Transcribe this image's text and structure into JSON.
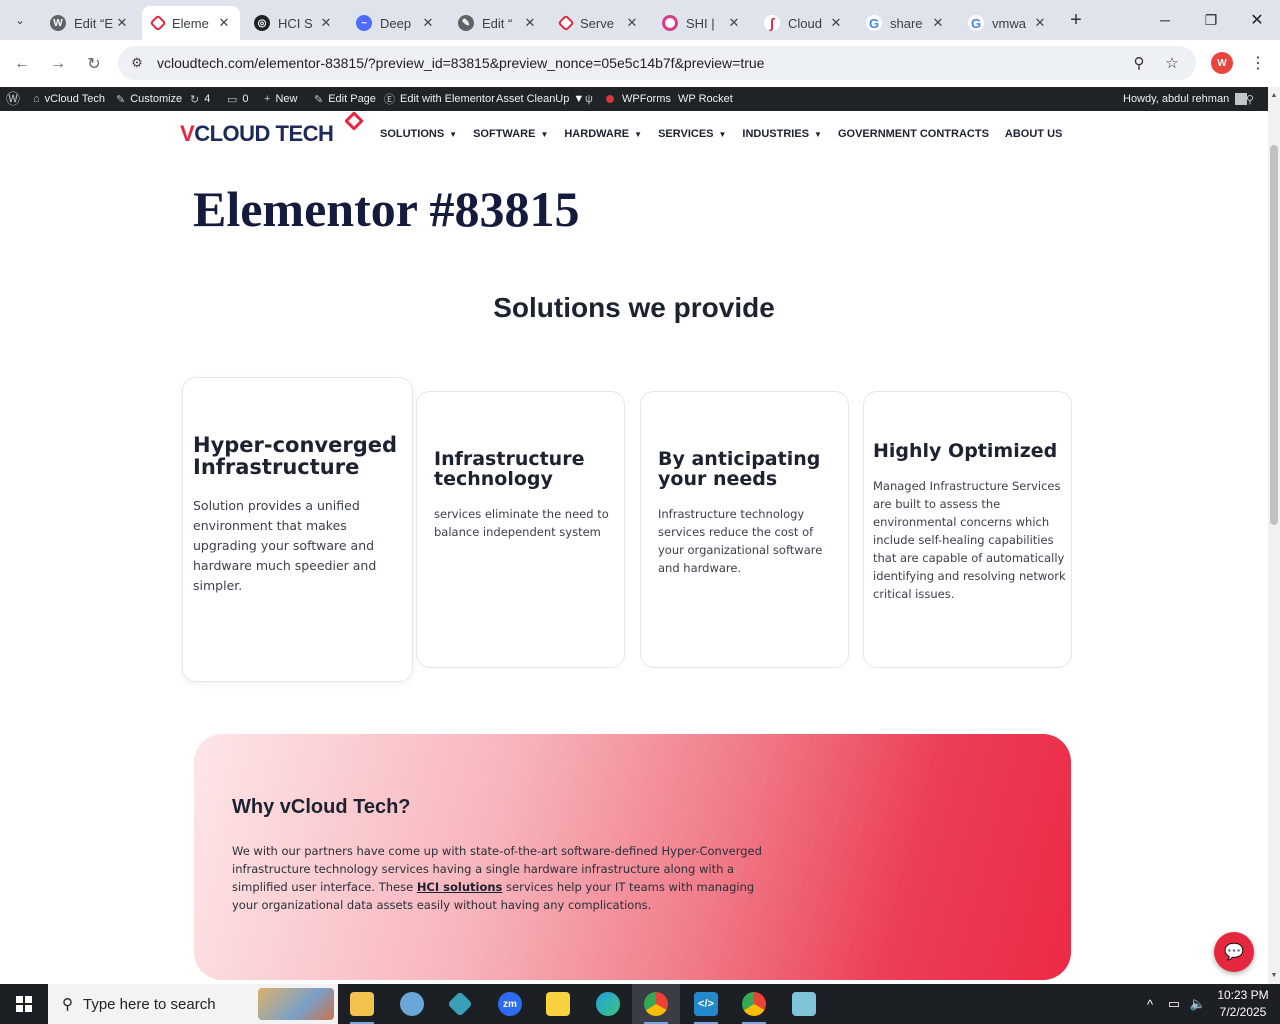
{
  "browser": {
    "tabs": [
      {
        "title": "Edit “E",
        "icon": "wordpress-icon",
        "color": "#5f6368"
      },
      {
        "title": "Eleme",
        "icon": "vcloud-icon",
        "color": "#e5283f",
        "active": true
      },
      {
        "title": "HCI S",
        "icon": "openai-icon",
        "color": "#202124"
      },
      {
        "title": "Deep",
        "icon": "deepseek-icon",
        "color": "#4d6bfe"
      },
      {
        "title": "Edit “",
        "icon": "wordpress-edit-icon",
        "color": "#5f6368"
      },
      {
        "title": "Serve",
        "icon": "vcloud-icon",
        "color": "#e5283f"
      },
      {
        "title": "SHI | ",
        "icon": "shi-icon",
        "color": "#d93a8a"
      },
      {
        "title": "Cloud",
        "icon": "cloud-icon",
        "color": "#e5283f"
      },
      {
        "title": "share",
        "icon": "google-icon",
        "color": "#4285f4"
      },
      {
        "title": "vmwa",
        "icon": "google-icon",
        "color": "#4285f4"
      }
    ],
    "url": "vcloudtech.com/elementor-83815/?preview_id=83815&preview_nonce=05e5c14b7f&preview=true",
    "profile_initial": "W"
  },
  "adminbar": {
    "site": "vCloud Tech",
    "customize": "Customize",
    "updates_count": "4",
    "comments_count": "0",
    "new": "New",
    "edit_page": "Edit Page",
    "edit_elementor": "Edit with Elementor",
    "asset_cleanup": "Asset CleanUp",
    "wpforms": "WPForms",
    "wp_rocket": "WP Rocket",
    "howdy": "Howdy, abdul rehman"
  },
  "site": {
    "logo_v": "V",
    "logo_rest": "CLOUD TECH",
    "nav": [
      {
        "label": "SOLUTIONS",
        "caret": true
      },
      {
        "label": "SOFTWARE",
        "caret": true
      },
      {
        "label": "HARDWARE",
        "caret": true
      },
      {
        "label": "SERVICES",
        "caret": true
      },
      {
        "label": "INDUSTRIES",
        "caret": true
      },
      {
        "label": "GOVERNMENT CONTRACTS",
        "caret": false
      },
      {
        "label": "ABOUT US",
        "caret": false
      }
    ]
  },
  "content": {
    "page_title": "Elementor #83815",
    "section_title": "Solutions we provide",
    "cards": [
      {
        "title": "Hyper-converged Infrastructure",
        "text": "Solution provides a unified environment that makes upgrading your software and hardware much speedier and simpler."
      },
      {
        "title": "Infrastructure technology",
        "text": "services eliminate the need to balance independent system"
      },
      {
        "title": "By anticipating your needs",
        "text": "Infrastructure technology services reduce the cost of your organizational software and hardware."
      },
      {
        "title": "Highly Optimized",
        "text": "Managed Infrastructure Services are built to assess the environmental concerns which include self-healing capabilities that are capable of automatically identifying and resolving network critical issues."
      }
    ],
    "why": {
      "title": "Why vCloud Tech?",
      "text_before": "We with our partners have come up with state-of-the-art software-defined Hyper-Converged infrastructure technology services having a single hardware infrastructure along with a simplified user interface. These ",
      "link": "HCI solutions",
      "text_after": " services help your IT teams with managing your organizational data assets easily without having any complications."
    }
  },
  "taskbar": {
    "search_placeholder": "Type here to search",
    "time": "10:23 PM",
    "date": "7/2/2025"
  },
  "colors": {
    "brand_red": "#e5283f",
    "brand_navy": "#1c2a5a",
    "admin_bar": "#1d2327"
  }
}
